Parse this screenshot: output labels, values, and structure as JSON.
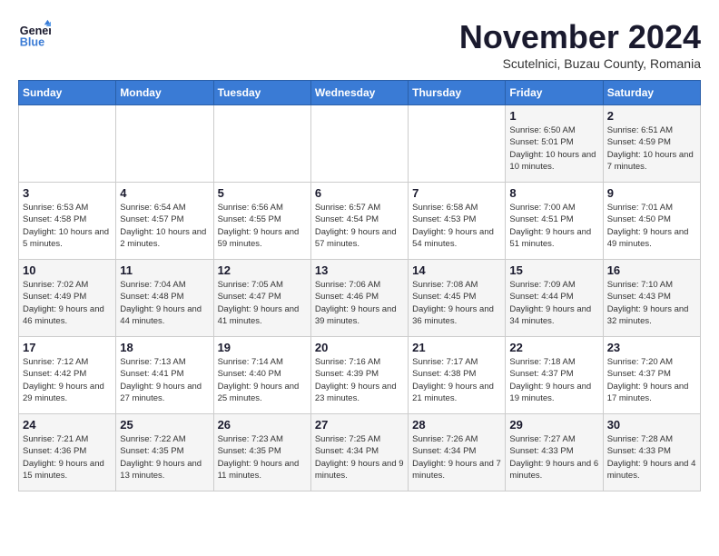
{
  "header": {
    "logo_line1": "General",
    "logo_line2": "Blue",
    "title": "November 2024",
    "subtitle": "Scutelnici, Buzau County, Romania"
  },
  "weekdays": [
    "Sunday",
    "Monday",
    "Tuesday",
    "Wednesday",
    "Thursday",
    "Friday",
    "Saturday"
  ],
  "weeks": [
    [
      {
        "day": "",
        "info": ""
      },
      {
        "day": "",
        "info": ""
      },
      {
        "day": "",
        "info": ""
      },
      {
        "day": "",
        "info": ""
      },
      {
        "day": "",
        "info": ""
      },
      {
        "day": "1",
        "info": "Sunrise: 6:50 AM\nSunset: 5:01 PM\nDaylight: 10 hours and 10 minutes."
      },
      {
        "day": "2",
        "info": "Sunrise: 6:51 AM\nSunset: 4:59 PM\nDaylight: 10 hours and 7 minutes."
      }
    ],
    [
      {
        "day": "3",
        "info": "Sunrise: 6:53 AM\nSunset: 4:58 PM\nDaylight: 10 hours and 5 minutes."
      },
      {
        "day": "4",
        "info": "Sunrise: 6:54 AM\nSunset: 4:57 PM\nDaylight: 10 hours and 2 minutes."
      },
      {
        "day": "5",
        "info": "Sunrise: 6:56 AM\nSunset: 4:55 PM\nDaylight: 9 hours and 59 minutes."
      },
      {
        "day": "6",
        "info": "Sunrise: 6:57 AM\nSunset: 4:54 PM\nDaylight: 9 hours and 57 minutes."
      },
      {
        "day": "7",
        "info": "Sunrise: 6:58 AM\nSunset: 4:53 PM\nDaylight: 9 hours and 54 minutes."
      },
      {
        "day": "8",
        "info": "Sunrise: 7:00 AM\nSunset: 4:51 PM\nDaylight: 9 hours and 51 minutes."
      },
      {
        "day": "9",
        "info": "Sunrise: 7:01 AM\nSunset: 4:50 PM\nDaylight: 9 hours and 49 minutes."
      }
    ],
    [
      {
        "day": "10",
        "info": "Sunrise: 7:02 AM\nSunset: 4:49 PM\nDaylight: 9 hours and 46 minutes."
      },
      {
        "day": "11",
        "info": "Sunrise: 7:04 AM\nSunset: 4:48 PM\nDaylight: 9 hours and 44 minutes."
      },
      {
        "day": "12",
        "info": "Sunrise: 7:05 AM\nSunset: 4:47 PM\nDaylight: 9 hours and 41 minutes."
      },
      {
        "day": "13",
        "info": "Sunrise: 7:06 AM\nSunset: 4:46 PM\nDaylight: 9 hours and 39 minutes."
      },
      {
        "day": "14",
        "info": "Sunrise: 7:08 AM\nSunset: 4:45 PM\nDaylight: 9 hours and 36 minutes."
      },
      {
        "day": "15",
        "info": "Sunrise: 7:09 AM\nSunset: 4:44 PM\nDaylight: 9 hours and 34 minutes."
      },
      {
        "day": "16",
        "info": "Sunrise: 7:10 AM\nSunset: 4:43 PM\nDaylight: 9 hours and 32 minutes."
      }
    ],
    [
      {
        "day": "17",
        "info": "Sunrise: 7:12 AM\nSunset: 4:42 PM\nDaylight: 9 hours and 29 minutes."
      },
      {
        "day": "18",
        "info": "Sunrise: 7:13 AM\nSunset: 4:41 PM\nDaylight: 9 hours and 27 minutes."
      },
      {
        "day": "19",
        "info": "Sunrise: 7:14 AM\nSunset: 4:40 PM\nDaylight: 9 hours and 25 minutes."
      },
      {
        "day": "20",
        "info": "Sunrise: 7:16 AM\nSunset: 4:39 PM\nDaylight: 9 hours and 23 minutes."
      },
      {
        "day": "21",
        "info": "Sunrise: 7:17 AM\nSunset: 4:38 PM\nDaylight: 9 hours and 21 minutes."
      },
      {
        "day": "22",
        "info": "Sunrise: 7:18 AM\nSunset: 4:37 PM\nDaylight: 9 hours and 19 minutes."
      },
      {
        "day": "23",
        "info": "Sunrise: 7:20 AM\nSunset: 4:37 PM\nDaylight: 9 hours and 17 minutes."
      }
    ],
    [
      {
        "day": "24",
        "info": "Sunrise: 7:21 AM\nSunset: 4:36 PM\nDaylight: 9 hours and 15 minutes."
      },
      {
        "day": "25",
        "info": "Sunrise: 7:22 AM\nSunset: 4:35 PM\nDaylight: 9 hours and 13 minutes."
      },
      {
        "day": "26",
        "info": "Sunrise: 7:23 AM\nSunset: 4:35 PM\nDaylight: 9 hours and 11 minutes."
      },
      {
        "day": "27",
        "info": "Sunrise: 7:25 AM\nSunset: 4:34 PM\nDaylight: 9 hours and 9 minutes."
      },
      {
        "day": "28",
        "info": "Sunrise: 7:26 AM\nSunset: 4:34 PM\nDaylight: 9 hours and 7 minutes."
      },
      {
        "day": "29",
        "info": "Sunrise: 7:27 AM\nSunset: 4:33 PM\nDaylight: 9 hours and 6 minutes."
      },
      {
        "day": "30",
        "info": "Sunrise: 7:28 AM\nSunset: 4:33 PM\nDaylight: 9 hours and 4 minutes."
      }
    ]
  ]
}
